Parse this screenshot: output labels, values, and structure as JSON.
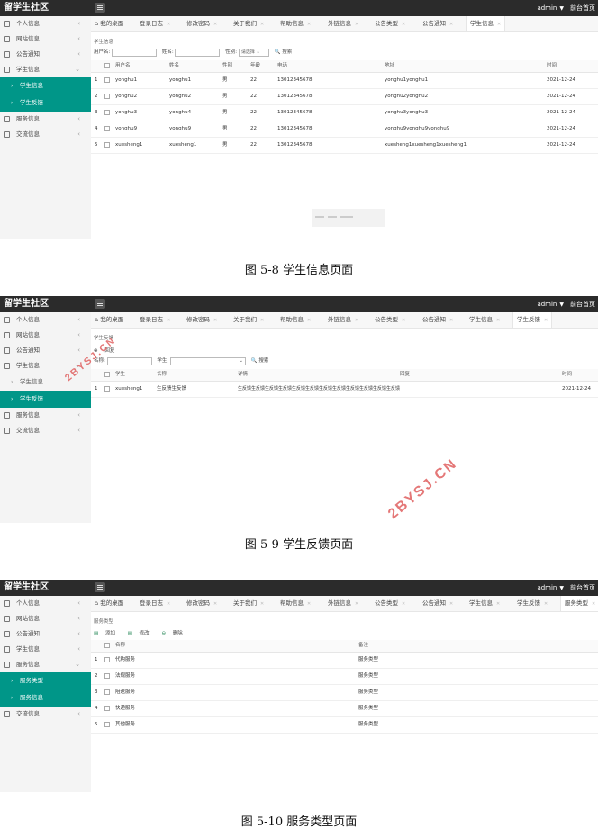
{
  "app_title": "留学生社区",
  "user_label": "admin",
  "front_page": "前台首页",
  "figures": [
    {
      "caption": "图 5-8 学生信息页面",
      "sidebar": [
        {
          "label": "个人信息",
          "type": "item",
          "icon": "person-icon",
          "arrow": "‹"
        },
        {
          "label": "网站信息",
          "type": "item",
          "icon": "grid-icon",
          "arrow": "‹"
        },
        {
          "label": "公告通知",
          "type": "item",
          "icon": "doc-icon",
          "arrow": "‹"
        },
        {
          "label": "学生信息",
          "type": "item",
          "icon": "doc-icon",
          "arrow": "⌄"
        },
        {
          "label": "学生信息",
          "type": "sub",
          "active": true
        },
        {
          "label": "学生反馈",
          "type": "sub",
          "active": true
        },
        {
          "label": "服务信息",
          "type": "item",
          "icon": "grid-icon",
          "arrow": "‹"
        },
        {
          "label": "交流信息",
          "type": "item",
          "icon": "doc-icon",
          "arrow": "‹"
        }
      ],
      "tabs": [
        "我的桌面",
        "登录日志",
        "修改密码",
        "关于我们",
        "帮助信息",
        "外链信息",
        "公告类型",
        "公告通知",
        "学生信息"
      ],
      "active_tab": 8,
      "breadcrumb": "学生信息",
      "filters": {
        "label1": "用户名:",
        "label2": "姓名:",
        "label3": "性别:",
        "select": "请选择",
        "search": "搜索"
      },
      "columns": [
        "用户名",
        "姓名",
        "性别",
        "年龄",
        "电话",
        "地址",
        "时间"
      ],
      "rows": [
        [
          "yonghu1",
          "yonghu1",
          "男",
          "22",
          "13012345678",
          "yonghu1yonghu1",
          "2021-12-24"
        ],
        [
          "yonghu2",
          "yonghu2",
          "男",
          "22",
          "13012345678",
          "yonghu2yonghu2",
          "2021-12-24"
        ],
        [
          "yonghu3",
          "yonghu4",
          "男",
          "22",
          "13012345678",
          "yonghu3yonghu3",
          "2021-12-24"
        ],
        [
          "yonghu9",
          "yonghu9",
          "男",
          "22",
          "13012345678",
          "yonghu9yonghu9yonghu9",
          "2021-12-24"
        ],
        [
          "xuesheng1",
          "xuesheng1",
          "男",
          "22",
          "13012345678",
          "xuesheng1xuesheng1xuesheng1",
          "2021-12-24"
        ]
      ]
    },
    {
      "caption": "图 5-9 学生反馈页面",
      "sidebar": [
        {
          "label": "个人信息",
          "type": "item",
          "icon": "person-icon",
          "arrow": "‹"
        },
        {
          "label": "网站信息",
          "type": "item",
          "icon": "grid-icon",
          "arrow": "‹"
        },
        {
          "label": "公告通知",
          "type": "item",
          "icon": "doc-icon",
          "arrow": "‹"
        },
        {
          "label": "学生信息",
          "type": "item",
          "icon": "doc-icon",
          "arrow": "⌄"
        },
        {
          "label": "学生信息",
          "type": "sub",
          "active": false
        },
        {
          "label": "学生反馈",
          "type": "sub",
          "active": true
        },
        {
          "label": "服务信息",
          "type": "item",
          "icon": "grid-icon",
          "arrow": "‹"
        },
        {
          "label": "交流信息",
          "type": "item",
          "icon": "doc-icon",
          "arrow": "‹"
        }
      ],
      "tabs": [
        "我的桌面",
        "登录日志",
        "修改密码",
        "关于我们",
        "帮助信息",
        "外链信息",
        "公告类型",
        "公告通知",
        "学生信息",
        "学生反馈"
      ],
      "active_tab": 9,
      "breadcrumb": "学生反馈",
      "toolbar": [
        "回复"
      ],
      "filters": {
        "label1": "名称:",
        "label2": "学生:",
        "search": "搜索"
      },
      "columns": [
        "学生",
        "名称",
        "详情",
        "回复",
        "时间"
      ],
      "rows": [
        [
          "xuesheng1",
          "生反馈生反馈",
          "生反馈生反馈生反馈生反馈生反馈生反馈生反馈生反馈生反馈生反馈生反馈生反馈",
          "",
          "2021-12-24"
        ]
      ],
      "watermark": "2BYSJ.CN"
    },
    {
      "caption": "图 5-10 服务类型页面",
      "sidebar": [
        {
          "label": "个人信息",
          "type": "item",
          "icon": "person-icon",
          "arrow": "‹"
        },
        {
          "label": "网站信息",
          "type": "item",
          "icon": "grid-icon",
          "arrow": "‹"
        },
        {
          "label": "公告通知",
          "type": "item",
          "icon": "doc-icon",
          "arrow": "‹"
        },
        {
          "label": "学生信息",
          "type": "item",
          "icon": "doc-icon",
          "arrow": "‹"
        },
        {
          "label": "服务信息",
          "type": "item",
          "icon": "grid-icon",
          "arrow": "⌄"
        },
        {
          "label": "服务类型",
          "type": "sub",
          "active": true
        },
        {
          "label": "服务信息",
          "type": "sub",
          "active": true
        },
        {
          "label": "交流信息",
          "type": "item",
          "icon": "doc-icon",
          "arrow": "‹"
        }
      ],
      "tabs": [
        "我的桌面",
        "登录日志",
        "修改密码",
        "关于我们",
        "帮助信息",
        "外链信息",
        "公告类型",
        "公告通知",
        "学生信息",
        "学生反馈",
        "服务类型"
      ],
      "active_tab": 10,
      "breadcrumb": "服务类型",
      "toolbar": [
        "添加",
        "修改",
        "删除"
      ],
      "columns": [
        "名称",
        "备注"
      ],
      "rows": [
        [
          "代购服务",
          "服务类型"
        ],
        [
          "法规服务",
          "服务类型"
        ],
        [
          "陪送服务",
          "服务类型"
        ],
        [
          "快递服务",
          "服务类型"
        ],
        [
          "其他服务",
          "服务类型"
        ]
      ]
    }
  ]
}
